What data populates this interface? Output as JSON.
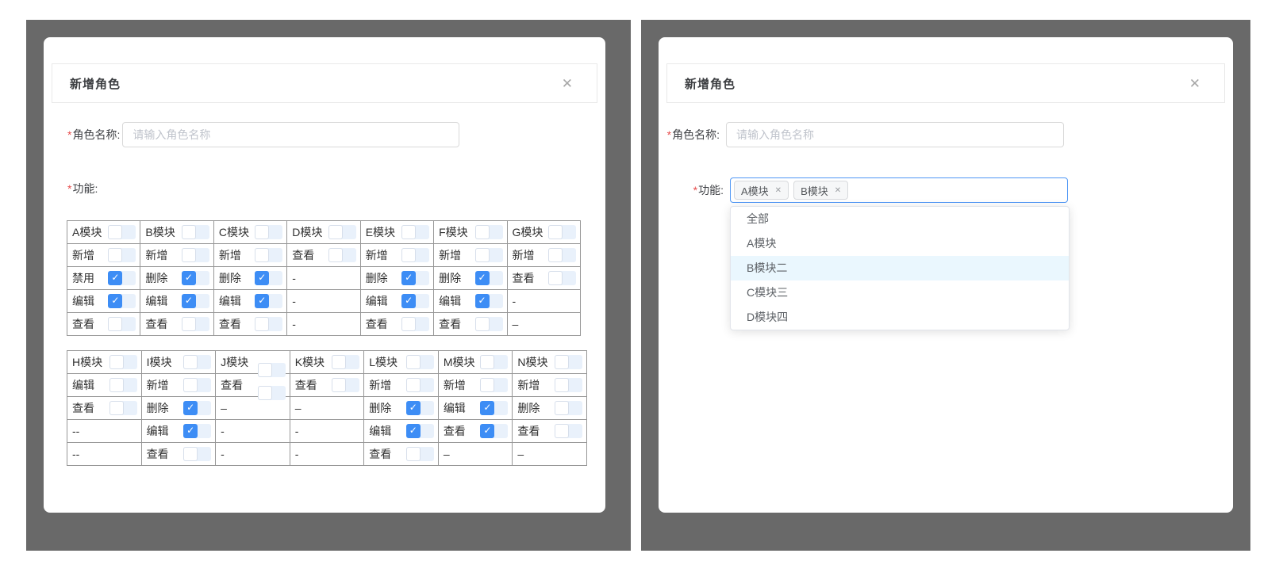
{
  "icons": {
    "close": "✕",
    "check": "✓",
    "tag_remove": "✕"
  },
  "colors": {
    "panel_bg": "#696969",
    "accent_blue": "#3d8df5",
    "select_focus_border": "#4f97f5",
    "option_highlight": "#eaf7fe",
    "required_red": "#e74c4c",
    "checkbox_tail": "#e9f1fb",
    "table_border": "#979797"
  },
  "left_dialog": {
    "title": "新增角色",
    "role_name_field": {
      "required_mark": "*",
      "label": "角色名称:",
      "placeholder": "请输入角色名称",
      "value": ""
    },
    "feature_field": {
      "required_mark": "*",
      "label": "功能:"
    },
    "permission_tables": [
      {
        "columns": [
          {
            "header": {
              "label": "A模块",
              "checkbox": "unchecked"
            },
            "cells": [
              {
                "label": "新增",
                "checkbox": "unchecked"
              },
              {
                "label": "禁用",
                "checkbox": "checked"
              },
              {
                "label": "编辑",
                "checkbox": "checked"
              },
              {
                "label": "查看",
                "checkbox": "unchecked"
              }
            ]
          },
          {
            "header": {
              "label": "B模块",
              "checkbox": "unchecked"
            },
            "cells": [
              {
                "label": "新增",
                "checkbox": "unchecked"
              },
              {
                "label": "删除",
                "checkbox": "checked"
              },
              {
                "label": "编辑",
                "checkbox": "checked"
              },
              {
                "label": "查看",
                "checkbox": "unchecked"
              }
            ]
          },
          {
            "header": {
              "label": "C模块",
              "checkbox": "unchecked"
            },
            "cells": [
              {
                "label": "新增",
                "checkbox": "unchecked"
              },
              {
                "label": "删除",
                "checkbox": "checked"
              },
              {
                "label": "编辑",
                "checkbox": "checked"
              },
              {
                "label": "查看",
                "checkbox": "unchecked"
              }
            ]
          },
          {
            "header": {
              "label": "D模块",
              "checkbox": "unchecked"
            },
            "cells": [
              {
                "label": "查看",
                "checkbox": "unchecked"
              },
              {
                "label": "-",
                "checkbox": "none"
              },
              {
                "label": "-",
                "checkbox": "none"
              },
              {
                "label": "-",
                "checkbox": "none"
              }
            ]
          },
          {
            "header": {
              "label": "E模块",
              "checkbox": "unchecked"
            },
            "cells": [
              {
                "label": "新增",
                "checkbox": "unchecked"
              },
              {
                "label": "删除",
                "checkbox": "checked"
              },
              {
                "label": "编辑",
                "checkbox": "checked"
              },
              {
                "label": "查看",
                "checkbox": "unchecked"
              }
            ]
          },
          {
            "header": {
              "label": "F模块",
              "checkbox": "unchecked"
            },
            "cells": [
              {
                "label": "新增",
                "checkbox": "unchecked"
              },
              {
                "label": "删除",
                "checkbox": "checked"
              },
              {
                "label": "编辑",
                "checkbox": "checked"
              },
              {
                "label": "查看",
                "checkbox": "unchecked"
              }
            ]
          },
          {
            "header": {
              "label": "G模块",
              "checkbox": "unchecked"
            },
            "cells": [
              {
                "label": "新增",
                "checkbox": "unchecked"
              },
              {
                "label": "查看",
                "checkbox": "unchecked"
              },
              {
                "label": "-",
                "checkbox": "none"
              },
              {
                "label": "–",
                "checkbox": "none"
              }
            ]
          }
        ]
      },
      {
        "columns": [
          {
            "header": {
              "label": "H模块",
              "checkbox": "unchecked"
            },
            "cells": [
              {
                "label": "编辑",
                "checkbox": "unchecked"
              },
              {
                "label": "查看",
                "checkbox": "unchecked"
              },
              {
                "label": "--",
                "checkbox": "none"
              },
              {
                "label": "--",
                "checkbox": "none"
              }
            ]
          },
          {
            "header": {
              "label": "I模块",
              "checkbox": "unchecked"
            },
            "cells": [
              {
                "label": "新增",
                "checkbox": "unchecked"
              },
              {
                "label": "删除",
                "checkbox": "checked"
              },
              {
                "label": "编辑",
                "checkbox": "checked"
              },
              {
                "label": "查看",
                "checkbox": "unchecked"
              }
            ]
          },
          {
            "header": {
              "label": "J模块",
              "checkbox": "unchecked",
              "offset": true
            },
            "cells": [
              {
                "label": "查看",
                "checkbox": "unchecked",
                "offset": true
              },
              {
                "label": "–",
                "checkbox": "none"
              },
              {
                "label": "-",
                "checkbox": "none"
              },
              {
                "label": "-",
                "checkbox": "none"
              }
            ]
          },
          {
            "header": {
              "label": "K模块",
              "checkbox": "unchecked"
            },
            "cells": [
              {
                "label": "查看",
                "checkbox": "unchecked"
              },
              {
                "label": "–",
                "checkbox": "none"
              },
              {
                "label": "-",
                "checkbox": "none"
              },
              {
                "label": "-",
                "checkbox": "none"
              }
            ]
          },
          {
            "header": {
              "label": "L模块",
              "checkbox": "unchecked"
            },
            "cells": [
              {
                "label": "新增",
                "checkbox": "unchecked"
              },
              {
                "label": "删除",
                "checkbox": "checked"
              },
              {
                "label": "编辑",
                "checkbox": "checked"
              },
              {
                "label": "查看",
                "checkbox": "unchecked"
              }
            ]
          },
          {
            "header": {
              "label": "M模块",
              "checkbox": "unchecked"
            },
            "cells": [
              {
                "label": "新增",
                "checkbox": "unchecked"
              },
              {
                "label": "编辑",
                "checkbox": "checked"
              },
              {
                "label": "查看",
                "checkbox": "checked"
              },
              {
                "label": "–",
                "checkbox": "none"
              }
            ]
          },
          {
            "header": {
              "label": "N模块",
              "checkbox": "unchecked"
            },
            "cells": [
              {
                "label": "新增",
                "checkbox": "unchecked"
              },
              {
                "label": "删除",
                "checkbox": "unchecked"
              },
              {
                "label": "查看",
                "checkbox": "unchecked"
              },
              {
                "label": "–",
                "checkbox": "none"
              }
            ]
          }
        ]
      }
    ]
  },
  "right_dialog": {
    "title": "新增角色",
    "role_name_field": {
      "required_mark": "*",
      "label": "角色名称:",
      "placeholder": "请输入角色名称",
      "value": ""
    },
    "feature_field": {
      "required_mark": "*",
      "label": "功能:",
      "selected_tags": [
        {
          "label": "A模块"
        },
        {
          "label": "B模块"
        }
      ],
      "dropdown_options": [
        {
          "label": "全部",
          "highlighted": false
        },
        {
          "label": "A模块",
          "highlighted": false
        },
        {
          "label": "B模块二",
          "highlighted": true
        },
        {
          "label": "C模块三",
          "highlighted": false
        },
        {
          "label": "D模块四",
          "highlighted": false
        }
      ]
    }
  }
}
